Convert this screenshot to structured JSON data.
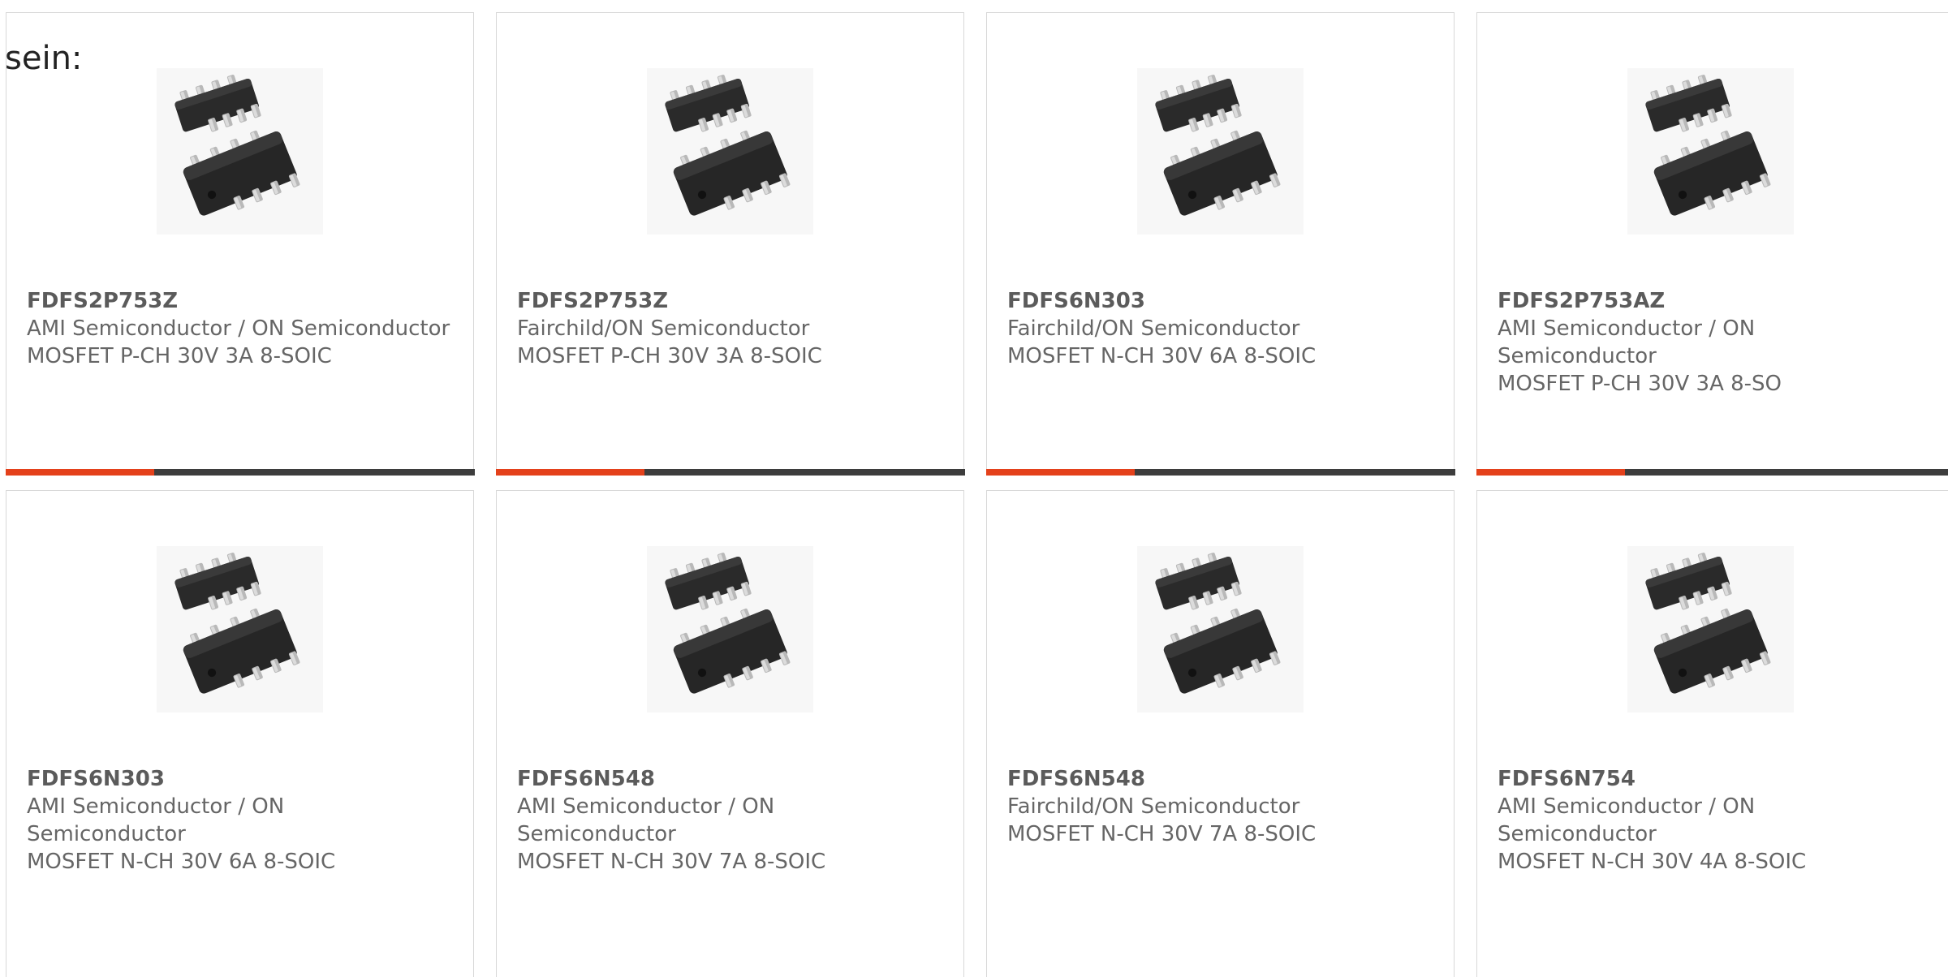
{
  "intro_text": "sein:",
  "colors": {
    "accent": "#e4411b",
    "bar": "#3d3d3d",
    "text": "#666666",
    "border": "#d8d8d8"
  },
  "products": [
    {
      "part": "FDFS2P753Z",
      "manufacturer": "AMI Semiconductor / ON Semiconductor",
      "description": "MOSFET P-CH 30V 3A 8-SOIC",
      "image_icon": "soic-8-chip-icon"
    },
    {
      "part": "FDFS2P753Z",
      "manufacturer": "Fairchild/ON Semiconductor",
      "description": "MOSFET P-CH 30V 3A 8-SOIC",
      "image_icon": "soic-8-chip-icon"
    },
    {
      "part": "FDFS6N303",
      "manufacturer": "Fairchild/ON Semiconductor",
      "description": "MOSFET N-CH 30V 6A 8-SOIC",
      "image_icon": "soic-8-chip-icon"
    },
    {
      "part": "FDFS2P753AZ",
      "manufacturer": "AMI Semiconductor / ON Semiconductor",
      "description": "MOSFET P-CH 30V 3A 8-SO",
      "image_icon": "soic-8-chip-icon"
    },
    {
      "part": "FDFS6N303",
      "manufacturer": "AMI Semiconductor / ON Semiconductor",
      "description": "MOSFET N-CH 30V 6A 8-SOIC",
      "image_icon": "soic-8-chip-icon"
    },
    {
      "part": "FDFS6N548",
      "manufacturer": "AMI Semiconductor / ON Semiconductor",
      "description": "MOSFET N-CH 30V 7A 8-SOIC",
      "image_icon": "soic-8-chip-icon"
    },
    {
      "part": "FDFS6N548",
      "manufacturer": "Fairchild/ON Semiconductor",
      "description": "MOSFET N-CH 30V 7A 8-SOIC",
      "image_icon": "soic-8-chip-icon"
    },
    {
      "part": "FDFS6N754",
      "manufacturer": "AMI Semiconductor / ON Semiconductor",
      "description": "MOSFET N-CH 30V 4A 8-SOIC",
      "image_icon": "soic-8-chip-icon"
    }
  ]
}
